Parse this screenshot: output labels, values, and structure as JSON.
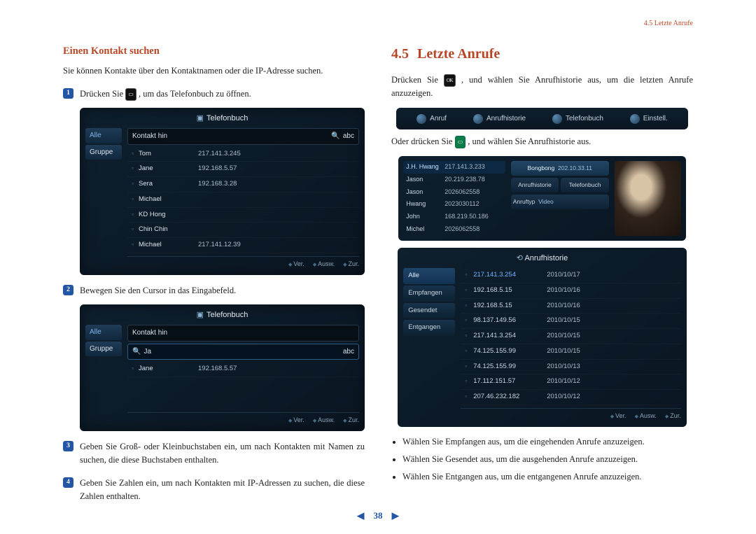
{
  "header": {
    "breadcrumb": "4.5 Letzte Anrufe"
  },
  "left": {
    "heading": "Einen Kontakt suchen",
    "intro": "Sie können Kontakte über den Kontaktnamen oder die IP-Adresse suchen.",
    "steps": {
      "s1_a": "Drücken Sie ",
      "s1_b": ", um das Telefonbuch zu öffnen.",
      "s2": "Bewegen Sie den Cursor in das Eingabefeld.",
      "s3": "Geben Sie Groß- oder Kleinbuchstaben ein, um nach Kontakten mit Namen zu suchen, die diese Buchstaben enthalten.",
      "s4": "Geben Sie Zahlen ein, um nach Kontakten mit IP-Adressen zu suchen, die diese Zahlen enthalten."
    },
    "screenshot_label": "Telefonbuch",
    "tabs": {
      "all": "Alle",
      "group": "Gruppe"
    },
    "search": {
      "placeholder": "Kontakt hin",
      "mode": "abc",
      "query2": "Ja"
    },
    "contacts": [
      {
        "name": "Tom",
        "ip": "217.141.3.245"
      },
      {
        "name": "Jane",
        "ip": "192.168.5.57"
      },
      {
        "name": "Sera",
        "ip": "192.168.3.28"
      },
      {
        "name": "Michael",
        "ip": ""
      },
      {
        "name": "KD Hong",
        "ip": ""
      },
      {
        "name": "Chin Chin",
        "ip": ""
      },
      {
        "name": "Michael",
        "ip": "217.141.12.39"
      }
    ],
    "contacts2": [
      {
        "name": "Jane",
        "ip": "192.168.5.57"
      }
    ],
    "footer": {
      "ver": "Ver.",
      "ausw": "Ausw.",
      "zur": "Zur."
    }
  },
  "right": {
    "heading_num": "4.5",
    "heading_text": "Letzte Anrufe",
    "p1_a": "Drücken Sie ",
    "p1_b": ", und wählen Sie Anrufhistorie aus, um die letzten Anrufe anzuzeigen.",
    "menubar": {
      "anruf": "Anruf",
      "hist": "Anrufhistorie",
      "tel": "Telefonbuch",
      "einst": "Einstell."
    },
    "p2_a": "Oder drücken Sie ",
    "p2_b": ", und wählen Sie Anrufhistorie aus.",
    "callui": {
      "head_name": "J.H. Hwang",
      "head_addr": "217.141.3.233",
      "rows": [
        {
          "n": "Jason",
          "a": "20.219.238.78"
        },
        {
          "n": "Jason",
          "a": "2026062558"
        },
        {
          "n": "Hwang",
          "a": "2023030112"
        },
        {
          "n": "John",
          "a": "168.219.50.186"
        },
        {
          "n": "Michel",
          "a": "2026062558"
        }
      ],
      "panel": {
        "head_name": "Bongbong",
        "head_addr": "202.10.33.11",
        "btn_hist": "Anrufhistorie",
        "btn_tel": "Telefonbuch",
        "type_label": "Anruftyp",
        "type_value": "Video"
      }
    },
    "hist": {
      "title": "Anrufhistorie",
      "tabs": {
        "all": "Alle",
        "recv": "Empfangen",
        "sent": "Gesendet",
        "missed": "Entgangen"
      },
      "rows": [
        {
          "ip": "217.141.3.254",
          "date": "2010/10/17"
        },
        {
          "ip": "192.168.5.15",
          "date": "2010/10/16"
        },
        {
          "ip": "192.168.5.15",
          "date": "2010/10/16"
        },
        {
          "ip": "98.137.149.56",
          "date": "2010/10/15"
        },
        {
          "ip": "217.141.3.254",
          "date": "2010/10/15"
        },
        {
          "ip": "74.125.155.99",
          "date": "2010/10/15"
        },
        {
          "ip": "74.125.155.99",
          "date": "2010/10/13"
        },
        {
          "ip": "17.112.151.57",
          "date": "2010/10/12"
        },
        {
          "ip": "207.46.232.182",
          "date": "2010/10/12"
        }
      ]
    },
    "bullets": {
      "b1": "Wählen Sie Empfangen aus, um die eingehenden Anrufe anzuzeigen.",
      "b2": "Wählen Sie Gesendet aus, um die ausgehenden Anrufe anzuzeigen.",
      "b3": "Wählen Sie Entgangen aus, um die entgangenen Anrufe anzuzeigen."
    }
  },
  "pagenav": {
    "page": "38"
  }
}
